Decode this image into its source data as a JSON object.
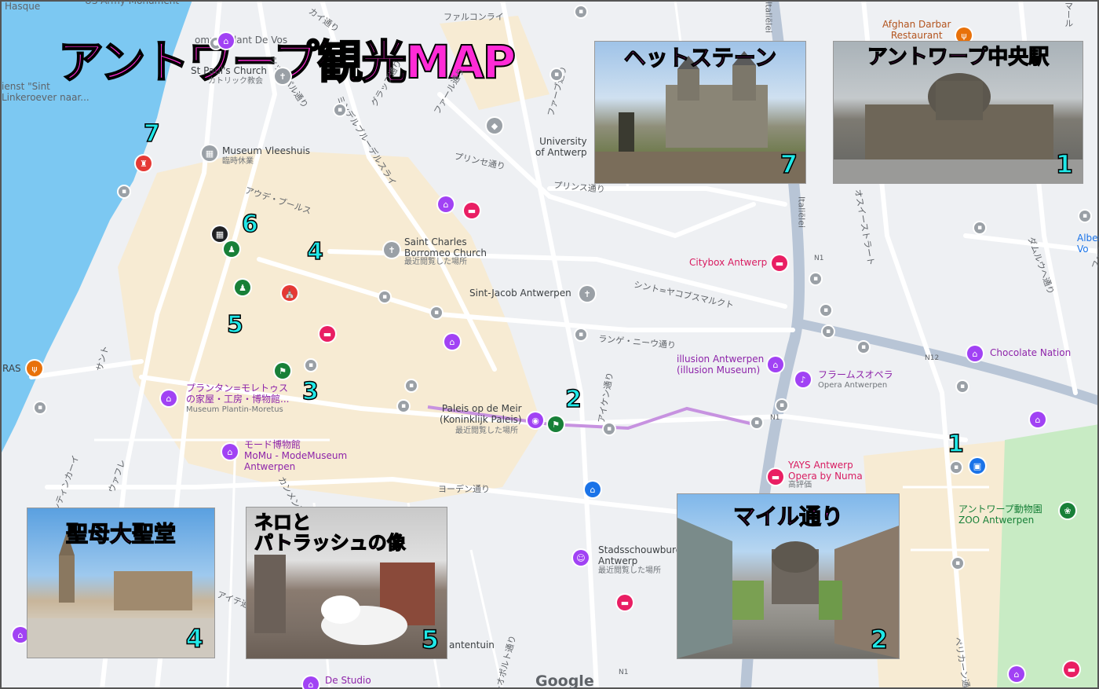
{
  "title": "アントワープ観光MAP",
  "labels": {
    "hasque": "Hasque",
    "us_army": "US Army Monument",
    "st_pauls": "St Paul's Church",
    "st_pauls_sub": "カトリック教会",
    "dienst": "ienst \"Sint\nLinkeroever naar...",
    "museum_vleeshuis": "Museum Vleeshuis",
    "museum_vleeshuis_sub": "臨時休業",
    "university": "University\nof Antwerp",
    "saint_charles": "Saint Charles\nBorromeo Church",
    "saint_charles_sub": "最近閲覧した場所",
    "sint_jacob": "Sint-Jacob Antwerpen",
    "citybox": "Citybox Antwerp",
    "afghan": "Afghan Darbar\nRestaurant",
    "albert": "Albert He\nVo",
    "chocolate": "Chocolate Nation",
    "illusion": "illusion Antwerpen\n(illusion Museum)",
    "opera_jp": "フラームスオペラ",
    "opera_en": "Opera Antwerpen",
    "plantin": "プランタン=モレトゥス\nの家屋・工房・博物館...",
    "plantin_sub": "Museum Plantin-Moretus",
    "meir": "Paleis op de Meir\n(Koninklijk Paleis)",
    "meir_sub": "最近閲覧した場所",
    "mode_museum": "モード博物館\nMoMu - ModeMuseum\nAntwerpen",
    "yays": "YAYS Antwerp\nOpera by Numa",
    "yays_sub": "高評価",
    "zoo": "アントワープ動物園\nZOO Antwerpen",
    "stadsschouwburg": "Stadsschouwburg\nAntwerp",
    "stadsschouwburg_sub": "最近閲覧した場所",
    "plantentuin": "antentuin",
    "de_studio": "De Studio",
    "ras": "RAS",
    "commandant": "ommandant De Vos",
    "google": "Google"
  },
  "roads": {
    "faruconrai": "ファルコンライ",
    "maru": "マール",
    "kai": "カイ通り",
    "schip": "シップパル通り",
    "minder": "ミンデルブルーデルスライ",
    "gulab": "グラップ通り",
    "fabu": "ファーブ通り",
    "fare": "ファール通り",
    "prinsu": "プリンセ通り",
    "prins": "プリンス通り",
    "oude_beurs": "アウデ・ブールス",
    "sint_jacob_markt": "シント=ヤコブスマルクト",
    "lange_nieuw": "ランゲ・ニーウ通り",
    "italielei": "Italiëlei",
    "osui": "オスイーストラート",
    "damulu": "ダムルウヘ通り",
    "n12": "N12",
    "n1": "N1",
    "aiken": "アイケン通り",
    "joden": "ヨーデン通り",
    "kammen": "カンメン通り",
    "sant": "サント",
    "plantin_kaai": "プランティンカーイ",
    "wafure": "ウァフレ",
    "peri": "ペリカーン通り",
    "reopold": "レオポルト通り",
    "furan": "フェランス通り",
    "maite": "アイテ通り"
  },
  "numbers": [
    "1",
    "2",
    "3",
    "4",
    "5",
    "6",
    "7",
    "1"
  ],
  "photos": [
    {
      "caption": "ヘットステーン",
      "number": "7"
    },
    {
      "caption": "アントワープ中央駅",
      "number": "1"
    },
    {
      "caption": "聖母大聖堂",
      "number": "4"
    },
    {
      "caption": "ネロと\nパトラッシュの像",
      "number": "5"
    },
    {
      "caption": "マイル通り",
      "number": "2"
    }
  ],
  "colors": {
    "title": "#ff2bd6",
    "number": "#20e8e8",
    "river": "#7cc8f2",
    "park": "#c8ebc4",
    "route": "#c792e0",
    "highway": "#b8c5d6"
  }
}
